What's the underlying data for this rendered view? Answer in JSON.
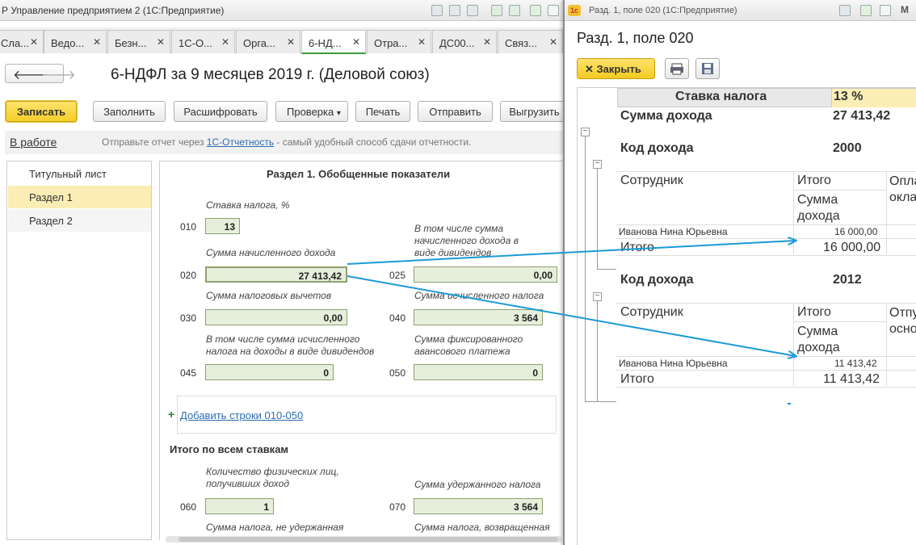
{
  "main_window": {
    "title": "Р Управление предприятием 2  (1С:Предприятие)",
    "tabs": [
      {
        "label": "Сла...",
        "active": false
      },
      {
        "label": "Ведо...",
        "active": false
      },
      {
        "label": "Безн...",
        "active": false
      },
      {
        "label": "1С-О...",
        "active": false
      },
      {
        "label": "Орга...",
        "active": false
      },
      {
        "label": "6-НД...",
        "active": true
      },
      {
        "label": "Отра...",
        "active": false
      },
      {
        "label": "ДС00...",
        "active": false
      },
      {
        "label": "Связ...",
        "active": false
      }
    ],
    "tab_close_glyph": "✕",
    "nav_back": "🡐",
    "nav_forward": "🡒",
    "document_title": "6-НДФЛ за 9 месяцев 2019 г. (Деловой союз)",
    "toolbar": {
      "save": "Записать",
      "fill": "Заполнить",
      "decode": "Расшифровать",
      "check": "Проверка",
      "check_arrow": "▾",
      "print": "Печать",
      "send": "Отправить",
      "export": "Выгрузить"
    },
    "status": "В работе",
    "info_prefix": "Отправьте отчет через ",
    "info_link": "1С-Отчетность",
    "info_suffix": " - самый удобный способ сдачи отчетности.",
    "nav_items": [
      "Титульный лист",
      "Раздел 1",
      "Раздел 2"
    ],
    "section_title": "Раздел 1. Обобщенные показатели",
    "fields": {
      "l010": "Ставка налога, %",
      "c010": "010",
      "v010": "13",
      "l020": "Сумма начисленного дохода",
      "c020": "020",
      "v020": "27 413,42",
      "l025": "В том числе сумма начисленного дохода в виде дивидендов",
      "c025": "025",
      "v025": "0,00",
      "l030": "Сумма налоговых вычетов",
      "c030": "030",
      "v030": "0,00",
      "l040": "Сумма исчисленного налога",
      "c040": "040",
      "v040": "3 564",
      "l045": "В том числе сумма исчисленного налога на доходы в виде дивидендов",
      "c045": "045",
      "v045": "0",
      "l050": "Сумма фиксированного авансового платежа",
      "c050": "050",
      "v050": "0"
    },
    "add_rows_plus": "+",
    "add_rows_link": "Добавить строки 010-050",
    "totals_title": "Итого по всем ставкам",
    "totals": {
      "l060": "Количество физических лиц, получивших доход",
      "c060": "060",
      "v060": "1",
      "l070": "Сумма удержанного налога",
      "c070": "070",
      "v070": "3 564",
      "l080": "Сумма налога, не удержанная",
      "l090": "Сумма налога, возвращенная"
    }
  },
  "detail_window": {
    "title": "Разд. 1, поле 020  (1С:Предприятие)",
    "heading": "Разд. 1, поле 020",
    "close_button": "Закрыть",
    "close_glyph": "✕",
    "rate_header": "Ставка налога",
    "rate_value": "13 %",
    "income_sum_label": "Сумма дохода",
    "income_sum_value": "27 413,42",
    "group_toggle_glyph": "−",
    "groups": [
      {
        "code_label": "Код дохода",
        "code_value": "2000",
        "col_employee": "Сотрудник",
        "col_total": "Итого",
        "col_total_sub": "Сумма дохода",
        "col_extra": "Оплата оклад",
        "row_name": "Иванова Нина Юрьевна",
        "row_value": "16 000,00",
        "total_label": "Итого",
        "total_value": "16 000,00"
      },
      {
        "code_label": "Код дохода",
        "code_value": "2012",
        "col_employee": "Сотрудник",
        "col_total": "Итого",
        "col_total_sub": "Сумма дохода",
        "col_extra": "Отпус осно",
        "row_name": "Иванова Нина Юрьевна",
        "row_value": "11 413,42",
        "total_label": "Итого",
        "total_value": "11 413,42"
      }
    ]
  },
  "colors": {
    "accent_yellow": "#f6ce2b",
    "field_green": "#e6efdc",
    "selected_nav": "#fbedb4",
    "link_blue": "#2a6cb3",
    "arrow_blue": "#1a9ad6"
  }
}
